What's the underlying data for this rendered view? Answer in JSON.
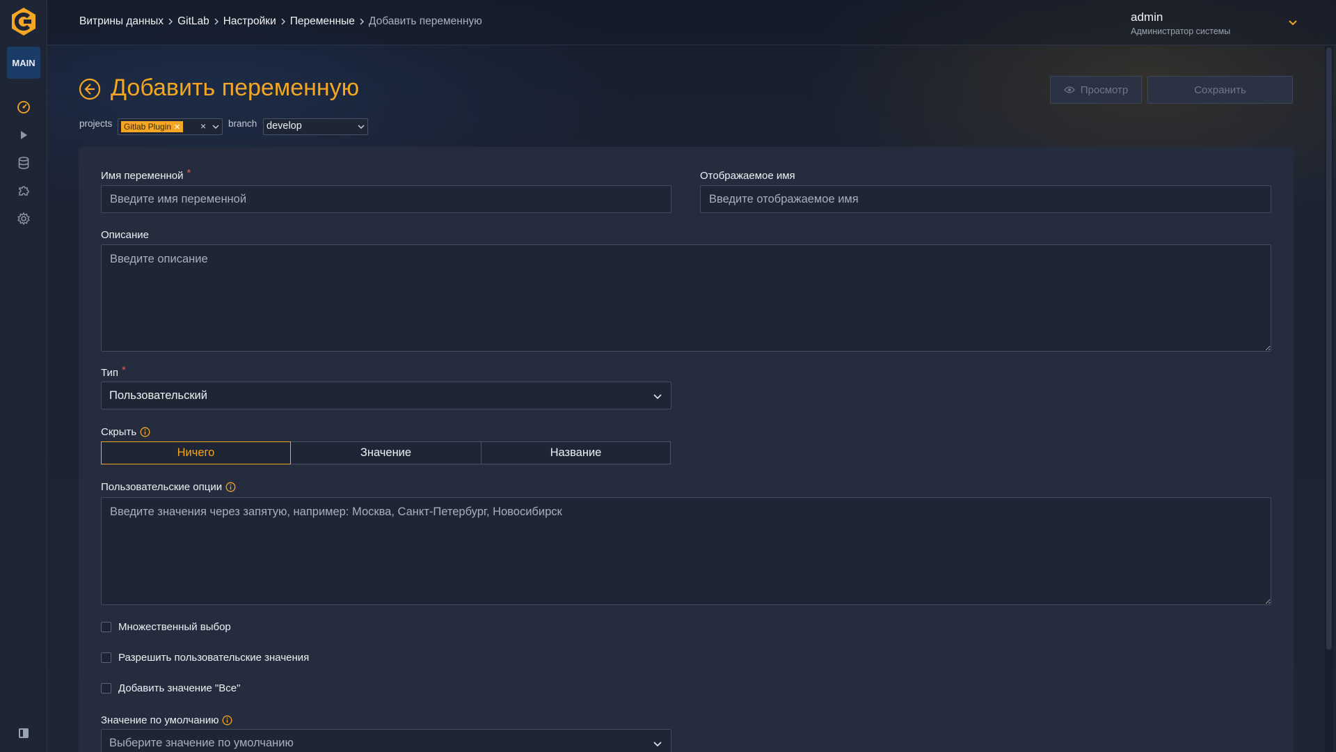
{
  "sidebar": {
    "badge": "MAIN",
    "icons": [
      "dashboard-icon",
      "play-icon",
      "database-icon",
      "puzzle-icon",
      "gear-icon"
    ],
    "bottom_icon": "panel-toggle-icon"
  },
  "header": {
    "breadcrumb": [
      "Витрины данных",
      "GitLab",
      "Настройки",
      "Переменные"
    ],
    "breadcrumb_current": "Добавить переменную",
    "user_name": "admin",
    "user_role": "Администратор системы"
  },
  "page": {
    "title": "Добавить переменную",
    "preview_button": "Просмотр",
    "save_button": "Сохранить",
    "projects_label": "projects",
    "project_tag": "Gitlab Plugin",
    "branch_label": "branch",
    "branch_value": "develop"
  },
  "form": {
    "name_label": "Имя переменной",
    "name_placeholder": "Введите имя переменной",
    "display_label": "Отображаемое имя",
    "display_placeholder": "Введите отображаемое имя",
    "description_label": "Описание",
    "description_placeholder": "Введите описание",
    "type_label": "Тип",
    "type_value": "Пользовательский",
    "hide_label": "Скрыть",
    "hide_options": [
      "Ничего",
      "Значение",
      "Название"
    ],
    "hide_selected": "Ничего",
    "custom_options_label": "Пользовательские опции",
    "custom_options_placeholder": "Введите значения через запятую, например: Москва, Санкт-Петербург, Новосибирск",
    "checkbox_multi": "Множественный выбор",
    "checkbox_custom": "Разрешить пользовательские значения",
    "checkbox_all": "Добавить значение \"Все\"",
    "default_label": "Значение по умолчанию",
    "default_placeholder": "Выберите значение по умолчанию",
    "required_mark": "*"
  },
  "colors": {
    "accent": "#f5a623",
    "required": "#e05a5a",
    "badge_bg": "#1a3c66"
  }
}
